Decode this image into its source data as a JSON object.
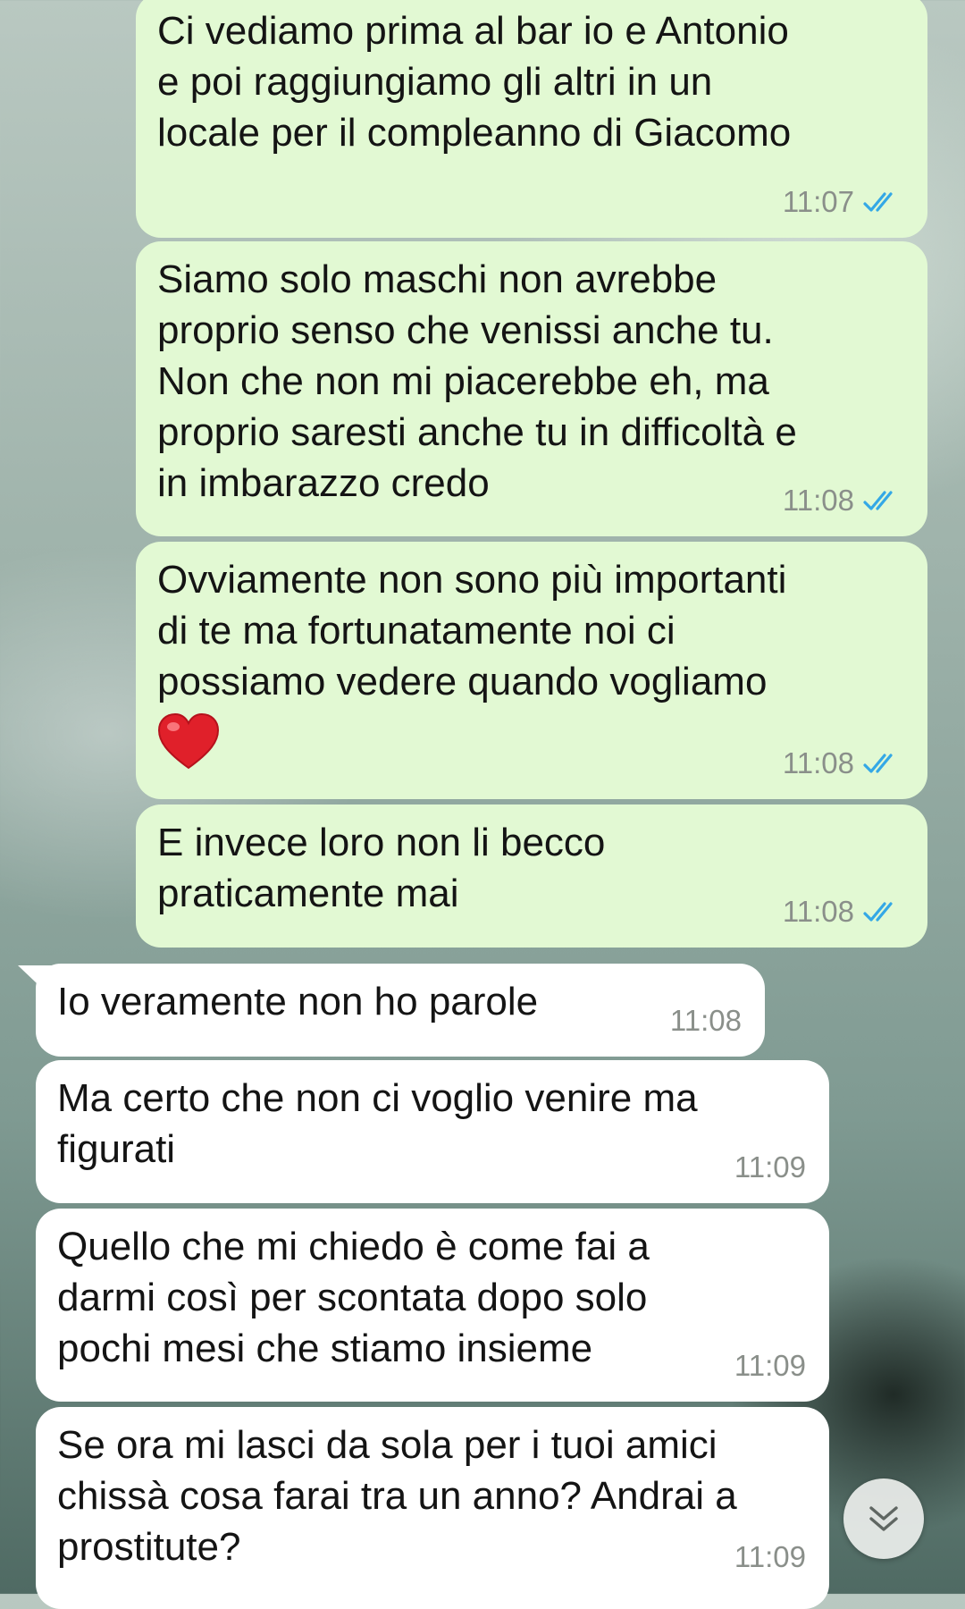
{
  "messages": [
    {
      "dir": "out",
      "text": "Ci vediamo prima al bar io e Antonio\ne poi raggiungiamo gli altri in un\nlocale per il compleanno di Giacomo",
      "time": "11:07"
    },
    {
      "dir": "out",
      "text": "Siamo solo maschi non avrebbe\nproprio senso che venissi anche tu.\nNon che non mi piacerebbe eh, ma\nproprio saresti anche tu in difficoltà e\nin imbarazzo credo",
      "time": "11:08"
    },
    {
      "dir": "out",
      "text": "Ovviamente non sono più importanti\ndi te ma fortunatamente noi ci\npossiamo vedere quando vogliamo",
      "emoji": "red-heart",
      "time": "11:08"
    },
    {
      "dir": "out",
      "text": "E invece loro non li becco\npraticamente mai",
      "time": "11:08"
    },
    {
      "dir": "in",
      "text": "Io veramente non ho parole",
      "time": "11:08"
    },
    {
      "dir": "in",
      "text": "Ma certo che non ci voglio venire ma\nfigurati",
      "time": "11:09"
    },
    {
      "dir": "in",
      "text": "Quello che mi chiedo è come fai a\ndarmi così per scontata dopo solo\npochi mesi che stiamo insieme",
      "time": "11:09"
    },
    {
      "dir": "in",
      "text": "Se ora mi lasci da sola per i tuoi amici\nchissà cosa farai tra un anno? Andrai a\nprostitute?",
      "time": "11:09"
    }
  ],
  "colors": {
    "outgoing_bubble": "#e2f9d3",
    "incoming_bubble": "#ffffff",
    "read_ticks": "#34a8e6",
    "timestamp": "#8a8f8a"
  },
  "scroll_button": {
    "icon": "double-chevron-down-icon"
  }
}
